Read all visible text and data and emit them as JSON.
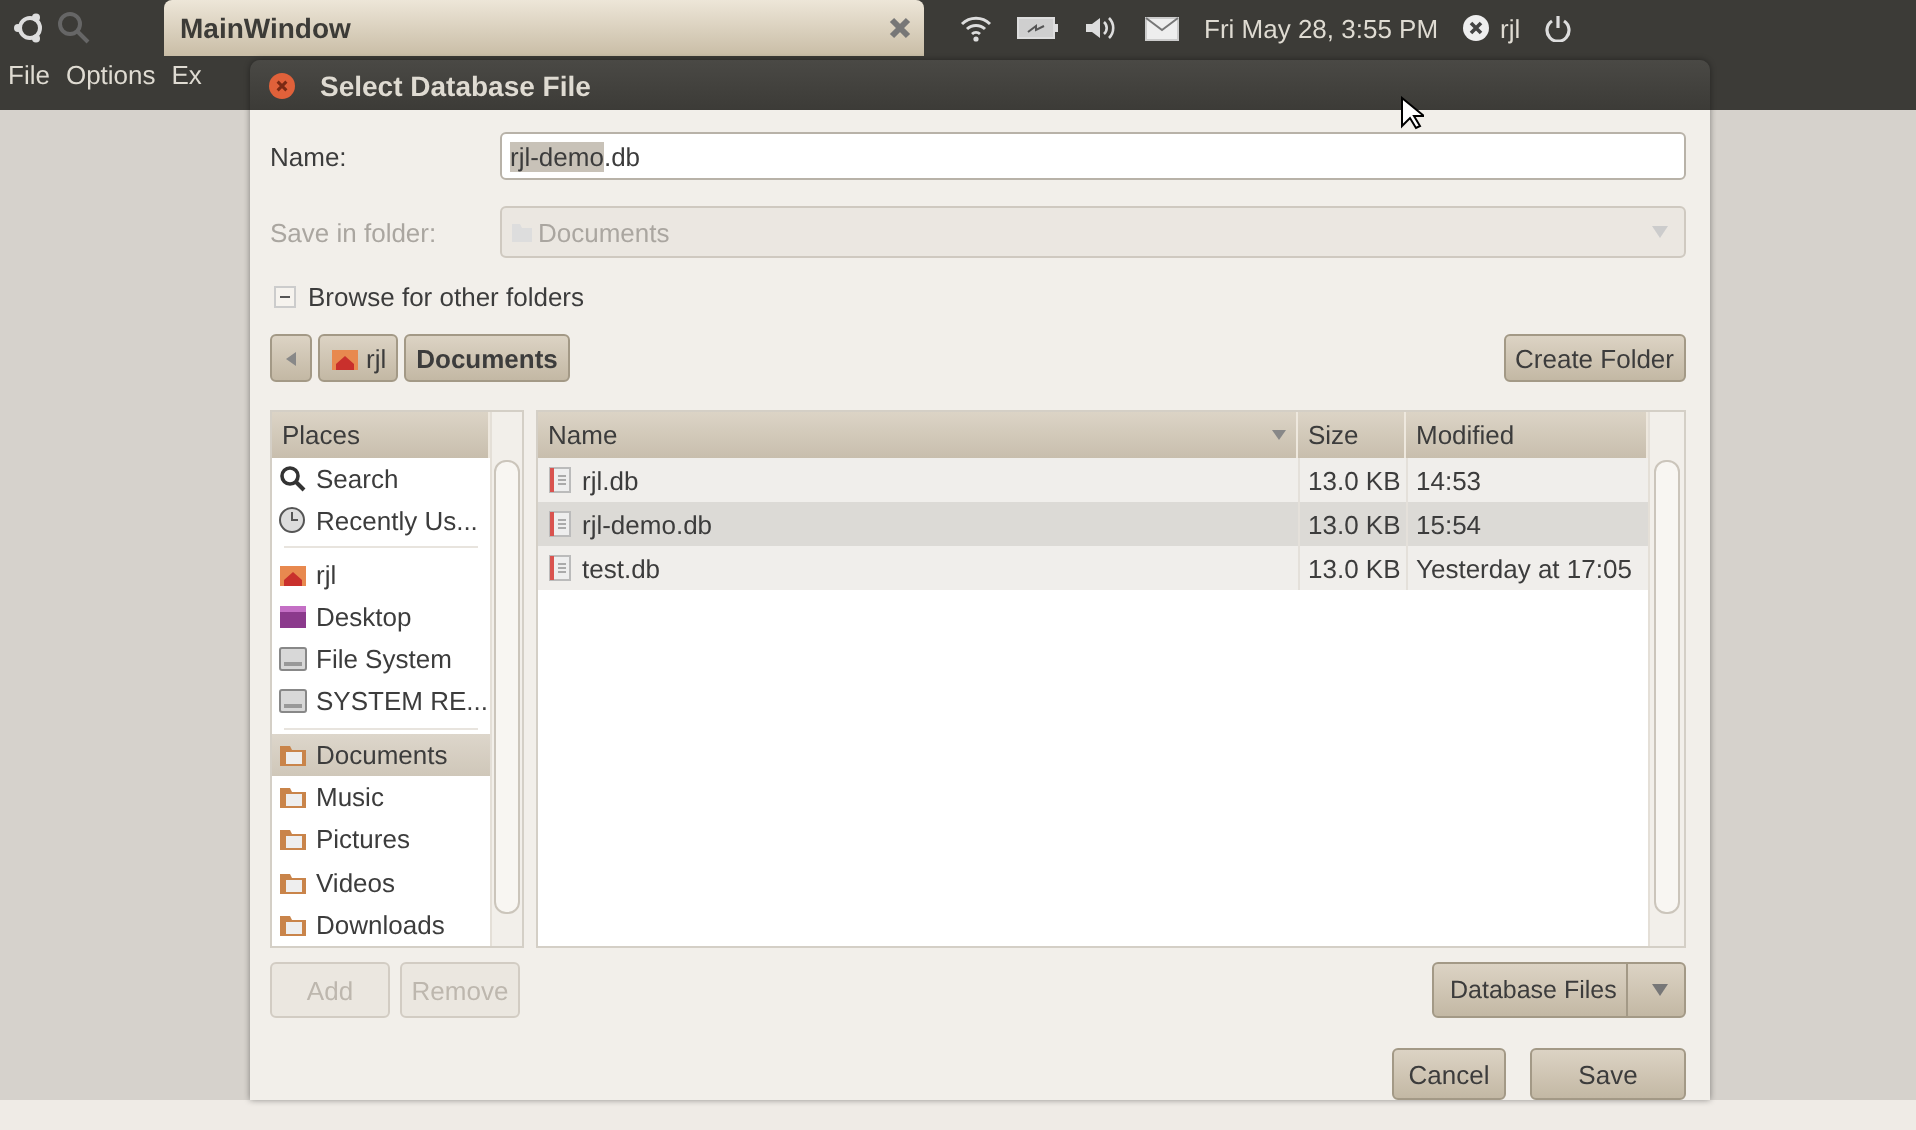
{
  "top_panel": {
    "app_title": "MainWindow",
    "clock": "Fri May 28,  3:55 PM",
    "user": "rjl"
  },
  "menu": [
    "File",
    "Options",
    "Ex"
  ],
  "dialog": {
    "title": "Select Database File",
    "name_field": {
      "label": "Name:",
      "selected_part": "rjl-demo",
      "rest": ".db"
    },
    "save_in": {
      "label": "Save in folder:",
      "value": "Documents",
      "disabled": true
    },
    "browse": {
      "label": "Browse for other folders",
      "expanded": true
    },
    "path": [
      {
        "label": "rjl",
        "kind": "home",
        "selected": false
      },
      {
        "label": "Documents",
        "kind": "plain",
        "selected": true
      }
    ],
    "create_folder": "Create Folder",
    "places": {
      "header": "Places",
      "sections": [
        [
          {
            "label": "Search",
            "kind": "search",
            "selected": false
          },
          {
            "label": "Recently Us...",
            "kind": "recent",
            "selected": false
          }
        ],
        [
          {
            "label": "rjl",
            "kind": "home",
            "selected": false
          },
          {
            "label": "Desktop",
            "kind": "desktop",
            "selected": false
          },
          {
            "label": "File System",
            "kind": "drive",
            "selected": false
          },
          {
            "label": "SYSTEM RE...",
            "kind": "drive",
            "selected": false
          }
        ],
        [
          {
            "label": "Documents",
            "kind": "folder",
            "selected": true
          },
          {
            "label": "Music",
            "kind": "folder",
            "selected": false
          },
          {
            "label": "Pictures",
            "kind": "folder",
            "selected": false
          },
          {
            "label": "Videos",
            "kind": "folder",
            "selected": false
          },
          {
            "label": "Downloads",
            "kind": "folder",
            "selected": false
          }
        ]
      ]
    },
    "files": {
      "columns": [
        {
          "label": "Name",
          "sorted": true
        },
        {
          "label": "Size",
          "sorted": false
        },
        {
          "label": "Modified",
          "sorted": false
        }
      ],
      "rows": [
        {
          "name": "rjl.db",
          "size": "13.0 KB",
          "modified": "14:53",
          "selected": false
        },
        {
          "name": "rjl-demo.db",
          "size": "13.0 KB",
          "modified": "15:54",
          "selected": true
        },
        {
          "name": "test.db",
          "size": "13.0 KB",
          "modified": "Yesterday at 17:05",
          "selected": false
        }
      ]
    },
    "add": {
      "label": "Add",
      "disabled": true
    },
    "remove": {
      "label": "Remove",
      "disabled": true
    },
    "filter": "Database Files",
    "buttons": [
      "Cancel",
      "Save"
    ]
  }
}
